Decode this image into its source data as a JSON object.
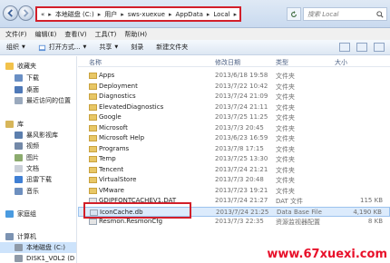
{
  "address": {
    "crumbs": [
      "本地磁盘 (C:)",
      "用户",
      "sws-xuexue",
      "AppData",
      "Local"
    ],
    "overflow": "«",
    "search_placeholder": "搜索 Local"
  },
  "menu": [
    "文件(F)",
    "编辑(E)",
    "查看(V)",
    "工具(T)",
    "帮助(H)"
  ],
  "toolbar": {
    "organize": "组织",
    "open": "打开方式...",
    "share": "共享",
    "burn": "刻录",
    "new_folder": "新建文件夹"
  },
  "sidebar": {
    "favorites": "收藏夹",
    "downloads": "下载",
    "desktop": "桌面",
    "recent": "最近访问的位置",
    "libraries": "库",
    "video_lib": "暴风影视库",
    "videos": "视频",
    "pictures": "图片",
    "documents": "文档",
    "thunder": "迅雷下载",
    "music": "音乐",
    "homegroup": "家庭组",
    "computer": "计算机",
    "local_c": "本地磁盘 (C:)",
    "disk1": "DISK1_VOL2 (D"
  },
  "columns": {
    "name": "名称",
    "date": "修改日期",
    "type": "类型",
    "size": "大小"
  },
  "files": [
    {
      "name": "Apps",
      "date": "2013/6/18 19:58",
      "type": "文件夹",
      "size": ""
    },
    {
      "name": "Deployment",
      "date": "2013/7/22 10:42",
      "type": "文件夹",
      "size": ""
    },
    {
      "name": "Diagnostics",
      "date": "2013/7/24 21:09",
      "type": "文件夹",
      "size": ""
    },
    {
      "name": "ElevatedDiagnostics",
      "date": "2013/7/24 21:11",
      "type": "文件夹",
      "size": ""
    },
    {
      "name": "Google",
      "date": "2013/7/25 11:25",
      "type": "文件夹",
      "size": ""
    },
    {
      "name": "Microsoft",
      "date": "2013/7/3 20:45",
      "type": "文件夹",
      "size": ""
    },
    {
      "name": "Microsoft Help",
      "date": "2013/6/23 16:59",
      "type": "文件夹",
      "size": ""
    },
    {
      "name": "Programs",
      "date": "2013/7/8 17:15",
      "type": "文件夹",
      "size": ""
    },
    {
      "name": "Temp",
      "date": "2013/7/25 13:30",
      "type": "文件夹",
      "size": ""
    },
    {
      "name": "Tencent",
      "date": "2013/7/24 21:21",
      "type": "文件夹",
      "size": ""
    },
    {
      "name": "VirtualStore",
      "date": "2013/7/3 20:48",
      "type": "文件夹",
      "size": ""
    },
    {
      "name": "VMware",
      "date": "2013/7/23 19:21",
      "type": "文件夹",
      "size": ""
    },
    {
      "name": "GDIPFONTCACHEV1.DAT",
      "date": "2013/7/24 21:27",
      "type": "DAT 文件",
      "size": "115 KB"
    },
    {
      "name": "IconCache.db",
      "date": "2013/7/24 21:25",
      "type": "Data Base File",
      "size": "4,190 KB"
    },
    {
      "name": "Resmon.ResmonCfg",
      "date": "2013/7/3 22:35",
      "type": "资源监视器配置",
      "size": "8 KB"
    }
  ],
  "watermark": "www.67xuexi.com",
  "colors": {
    "highlight_box": "#d21f2a",
    "folder": "#e8c766",
    "selection": "#dcebfc"
  }
}
